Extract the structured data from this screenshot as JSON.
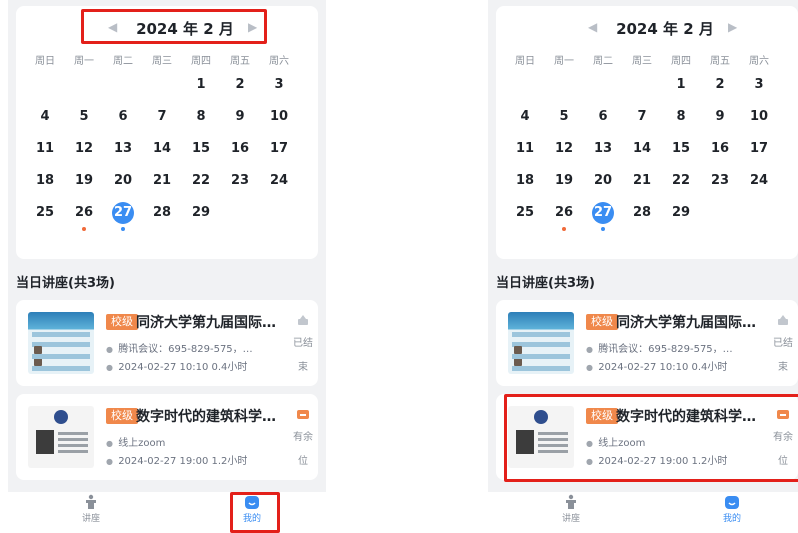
{
  "colors": {
    "highlight": "#e3201a",
    "accent": "#3a8df2",
    "tag": "#f0884b",
    "dot_red": "#f06a3a",
    "dot_blue": "#3a8df2"
  },
  "calendar": {
    "prev_icon": "caret-left-icon",
    "next_icon": "caret-right-icon",
    "month_label": "2024 年 2 月",
    "weekdays": [
      "周日",
      "周一",
      "周二",
      "周三",
      "周四",
      "周五",
      "周六"
    ],
    "days": [
      "1",
      "2",
      "3",
      "4",
      "5",
      "6",
      "7",
      "8",
      "9",
      "10",
      "11",
      "12",
      "13",
      "14",
      "15",
      "16",
      "17",
      "18",
      "19",
      "20",
      "21",
      "22",
      "23",
      "24",
      "25",
      "26",
      "27",
      "28",
      "29"
    ],
    "today": "27"
  },
  "section_title": "当日讲座(共3场)",
  "lectures": [
    {
      "tag": "校级",
      "title": "同济大学第九届国际博士生论坛",
      "location": "腾讯会议：695-829-575，…",
      "time": "2024-02-27 10:10 0.4小时",
      "status_icon": "bell-icon",
      "status_line1": "已结",
      "status_line2": "束"
    },
    {
      "tag": "校级",
      "title": "数字时代的建筑科学与技术",
      "location": "线上zoom",
      "time": "2024-02-27 19:00 1.2小时",
      "status_icon": "mailbox-icon",
      "status_line1": "有余",
      "status_line2": "位"
    }
  ],
  "tabbar": {
    "home_label": "讲座",
    "mine_label": "我的"
  }
}
